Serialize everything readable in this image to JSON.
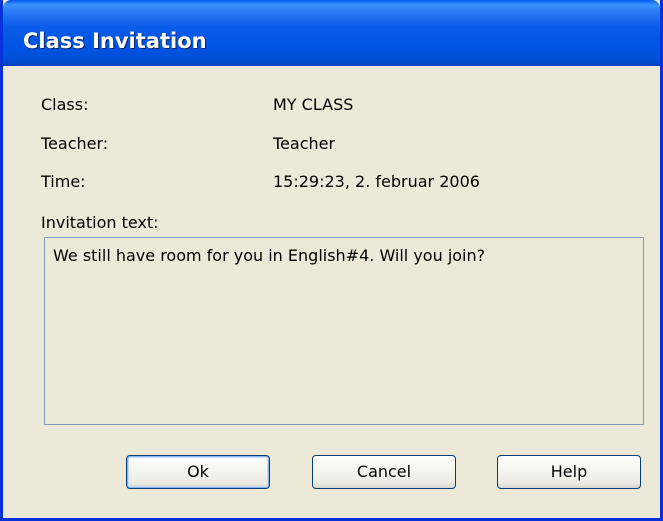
{
  "window": {
    "title": "Class Invitation"
  },
  "fields": {
    "class_label": "Class:",
    "class_value": "MY CLASS",
    "teacher_label": "Teacher:",
    "teacher_value": "Teacher",
    "time_label": "Time:",
    "time_value": "15:29:23, 2. februar 2006",
    "invitation_label": "Invitation text:",
    "invitation_text": "We still have room for you in English#4. Will you join?"
  },
  "buttons": {
    "ok": "Ok",
    "cancel": "Cancel",
    "help": "Help"
  },
  "colors": {
    "titlebar": "#0054e3",
    "window_bg": "#ece9d8",
    "frame": "#0831d9"
  }
}
